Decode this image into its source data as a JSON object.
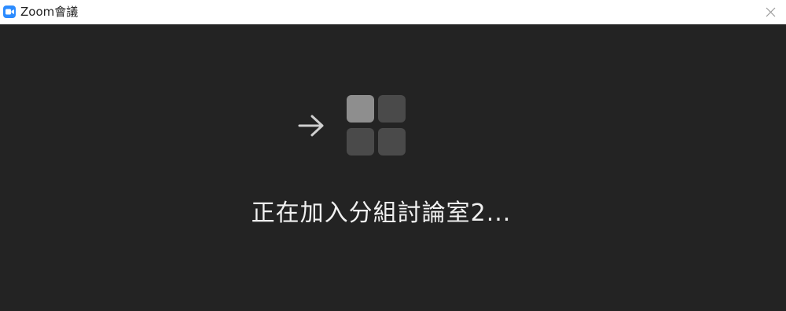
{
  "window": {
    "title": "Zoom會議",
    "app_icon": "zoom-camera-icon",
    "close_icon": "close-icon"
  },
  "content": {
    "status_text": "正在加入分組討論室2...",
    "arrow_icon": "arrow-right-icon",
    "rooms_icon": "breakout-rooms-grid-icon"
  },
  "colors": {
    "background": "#232323",
    "titlebar": "#ffffff",
    "accent": "#2d8cff",
    "tile_active": "#8e8e8e",
    "tile_inactive": "#4a4a4a"
  }
}
